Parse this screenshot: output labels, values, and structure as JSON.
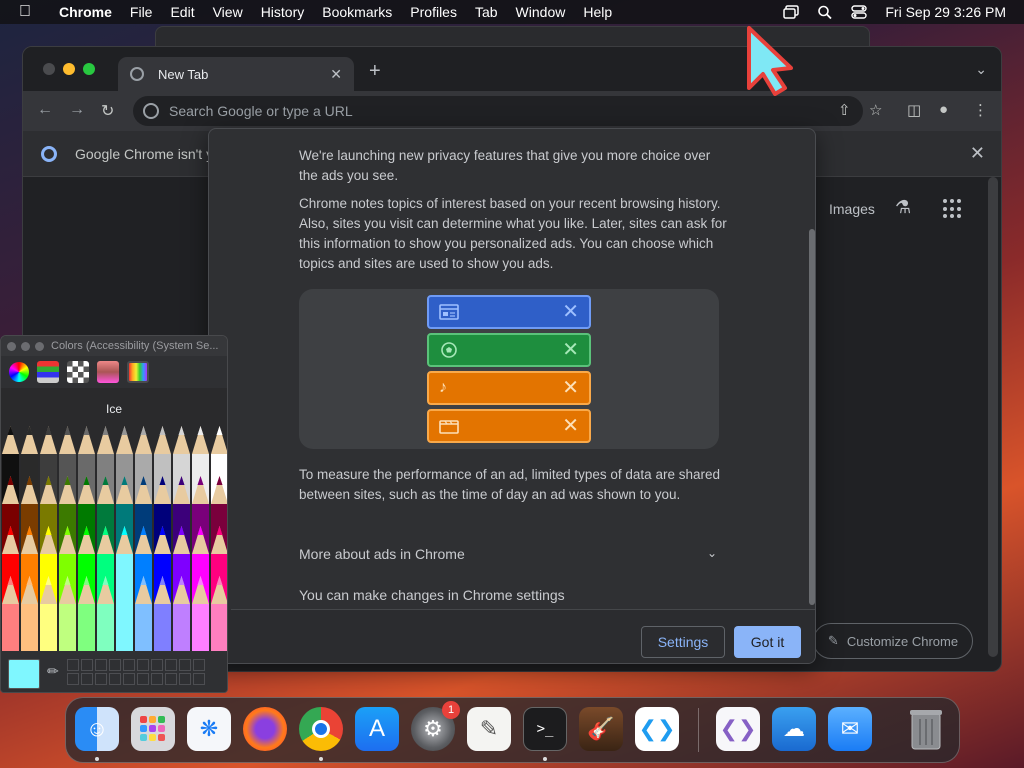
{
  "menubar": {
    "items": [
      "Chrome",
      "File",
      "Edit",
      "View",
      "History",
      "Bookmarks",
      "Profiles",
      "Tab",
      "Window",
      "Help"
    ],
    "datetime": "Fri Sep 29  3:26 PM"
  },
  "chrome": {
    "tab_title": "New Tab",
    "omnibox_placeholder": "Search Google or type a URL",
    "infobar_text": "Google Chrome isn't y",
    "ntp_images": "Images",
    "customize": "Customize Chrome"
  },
  "dialog": {
    "p1": "We're launching new privacy features that give you more choice over the ads you see.",
    "p2": "Chrome notes topics of interest based on your recent browsing history. Also, sites you visit can determine what you like. Later, sites can ask for this information to show you personalized ads. You can choose which topics and sites are used to show you ads.",
    "p3": "To measure the performance of an ad, limited types of data are shared between sites, such as the time of day an ad was shown to you.",
    "more": "More about ads in Chrome",
    "changes": "You can make changes in Chrome settings",
    "settings_button": "Settings",
    "gotit_button": "Got it",
    "chips": [
      {
        "icon": "newspaper-icon",
        "color": "#2f5fc8",
        "border": "#6f9bf5"
      },
      {
        "icon": "soccer-ball-icon",
        "color": "#1e8e3e",
        "border": "#5bc27a"
      },
      {
        "icon": "music-note-icon",
        "color": "#e37400",
        "border": "#f9a94a"
      },
      {
        "icon": "film-icon",
        "color": "#e37400",
        "border": "#f9a94a"
      }
    ]
  },
  "colors_panel": {
    "title": "Colors (Accessibility (System Se...",
    "selected_name": "Ice",
    "selected_color": "#7ff7ff"
  },
  "dock": {
    "apps": [
      "Finder",
      "Launchpad",
      "Safari",
      "Firefox",
      "Chrome",
      "App Store",
      "System Settings",
      "TextEdit",
      "Terminal",
      "GarageBand",
      "Visual Studio Code",
      "Visual Studio",
      "Weather",
      "Mail",
      "Trash"
    ],
    "settings_badge": "1"
  }
}
